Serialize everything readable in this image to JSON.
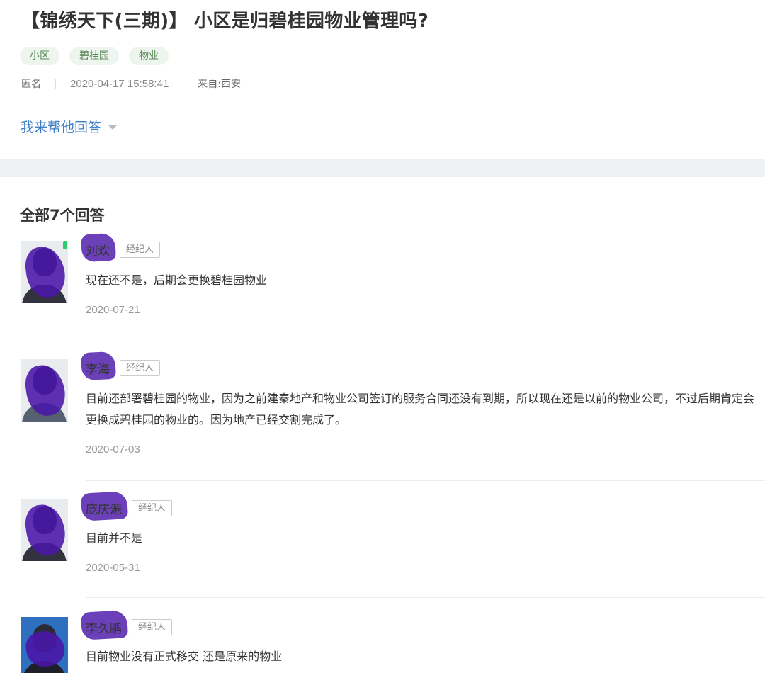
{
  "question": {
    "title": "【锦绣天下(三期)】 小区是归碧桂园物业管理吗?",
    "tags": [
      "小区",
      "碧桂园",
      "物业"
    ],
    "author": "匿名",
    "time": "2020-04-17 15:58:41",
    "location": "来自:西安",
    "help_label": "我来帮他回答"
  },
  "answers": {
    "heading": "全部7个回答",
    "badge_label": "经纪人",
    "items": [
      {
        "name": "刘欢",
        "content": "现在还不是，后期会更换碧桂园物业",
        "date": "2020-07-21"
      },
      {
        "name": "李海",
        "content": "目前还部署碧桂园的物业，因为之前建秦地产和物业公司签订的服务合同还没有到期，所以现在还是以前的物业公司，不过后期肯定会更换成碧桂园的物业的。因为地产已经交割完成了。",
        "date": "2020-07-03"
      },
      {
        "name": "庞庆源",
        "content": "目前并不是",
        "date": "2020-05-31"
      },
      {
        "name": "李久鹏",
        "content": "目前物业没有正式移交 还是原来的物业",
        "date": ""
      }
    ]
  },
  "colors": {
    "link": "#3e7ec6",
    "tag_bg": "#eef5ee",
    "tag_text": "#5a8a5a",
    "redaction": "#4a16a8"
  }
}
